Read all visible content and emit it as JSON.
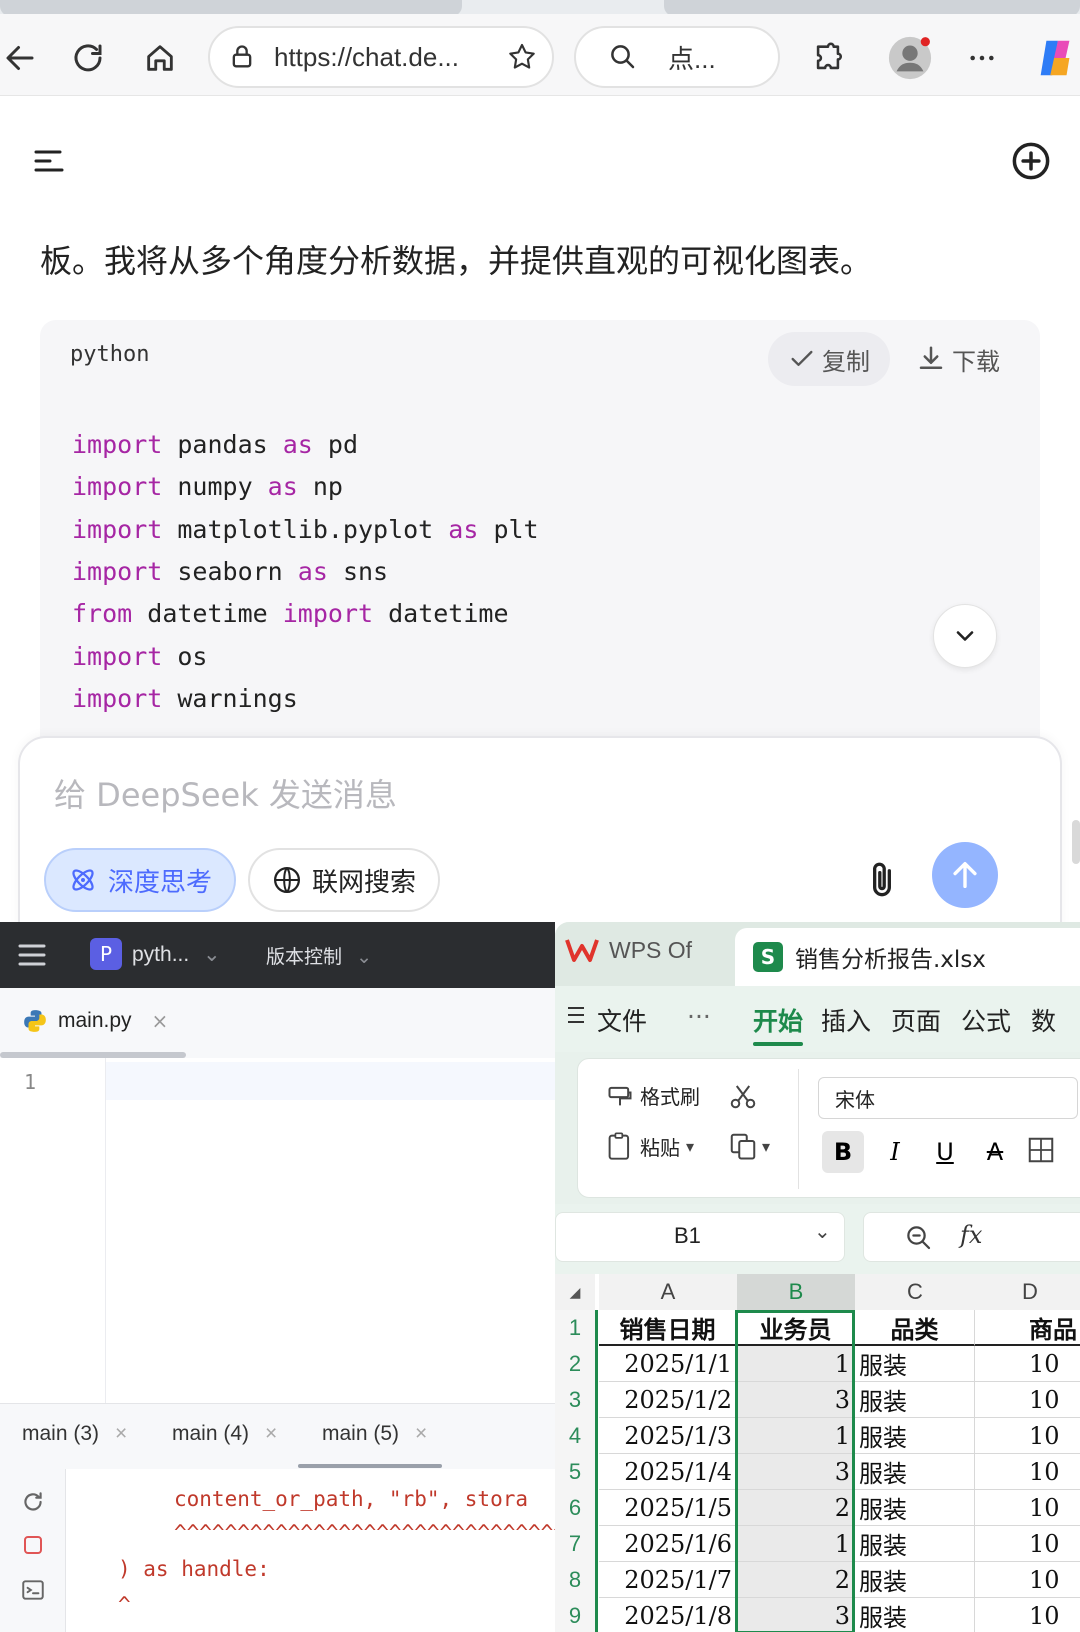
{
  "browser": {
    "url": "https://chat.de...",
    "search_text": "点..."
  },
  "deepseek": {
    "intro_text": "板。我将从多个角度分析数据，并提供直观的可视化图表。",
    "code": {
      "language": "python",
      "copy_label": "复制",
      "download_label": "下载",
      "lines": [
        [
          {
            "t": "import",
            "k": true
          },
          {
            "t": " pandas "
          },
          {
            "t": "as",
            "k": true
          },
          {
            "t": " pd"
          }
        ],
        [
          {
            "t": "import",
            "k": true
          },
          {
            "t": " numpy "
          },
          {
            "t": "as",
            "k": true
          },
          {
            "t": " np"
          }
        ],
        [
          {
            "t": "import",
            "k": true
          },
          {
            "t": " matplotlib.pyplot "
          },
          {
            "t": "as",
            "k": true
          },
          {
            "t": " plt"
          }
        ],
        [
          {
            "t": "import",
            "k": true
          },
          {
            "t": " seaborn "
          },
          {
            "t": "as",
            "k": true
          },
          {
            "t": " sns"
          }
        ],
        [
          {
            "t": "from",
            "k": true
          },
          {
            "t": " datetime "
          },
          {
            "t": "import",
            "k": true
          },
          {
            "t": " datetime"
          }
        ],
        [
          {
            "t": "import",
            "k": true
          },
          {
            "t": " os"
          }
        ],
        [
          {
            "t": "import",
            "k": true
          },
          {
            "t": " warnings"
          }
        ]
      ]
    },
    "composer": {
      "placeholder": "给 DeepSeek 发送消息",
      "deep_think_label": "深度思考",
      "web_search_label": "联网搜索"
    },
    "accent": "#4d6bfe"
  },
  "ide": {
    "project_label": "pyth...",
    "project_letter": "P",
    "vcs_label": "版本控制",
    "editor_tab": "main.py",
    "line_number": "1",
    "run_tabs": [
      "main (3)",
      "main (4)",
      "main (5)"
    ],
    "console_lines": [
      "    content_or_path, \"rb\", stora",
      "    ^^^^^^^^^^^^^^^^^^^^^^^^^^^^^^^^",
      ") as handle:",
      "^"
    ]
  },
  "wps": {
    "app_tab": "WPS Of",
    "file_tab": "销售分析报告.xlsx",
    "file_letter": "S",
    "menu": [
      "文件",
      "开始",
      "插入",
      "页面",
      "公式",
      "数"
    ],
    "active_menu": "开始",
    "ribbon": {
      "format_painter": "格式刷",
      "paste": "粘贴",
      "font": "宋体"
    },
    "name_box": "B1",
    "fx_label": "fx",
    "columns": [
      "A",
      "B",
      "C",
      "D"
    ],
    "header_row": [
      "销售日期",
      "业务员",
      "品类",
      "商品"
    ],
    "rows": [
      [
        "2025/1/1",
        "1",
        "服装",
        "10"
      ],
      [
        "2025/1/2",
        "3",
        "服装",
        "10"
      ],
      [
        "2025/1/3",
        "1",
        "服装",
        "10"
      ],
      [
        "2025/1/4",
        "3",
        "服装",
        "10"
      ],
      [
        "2025/1/5",
        "2",
        "服装",
        "10"
      ],
      [
        "2025/1/6",
        "1",
        "服装",
        "10"
      ],
      [
        "2025/1/7",
        "2",
        "服装",
        "10"
      ],
      [
        "2025/1/8",
        "3",
        "服装",
        "10"
      ]
    ],
    "accent": "#1e8a4c"
  }
}
